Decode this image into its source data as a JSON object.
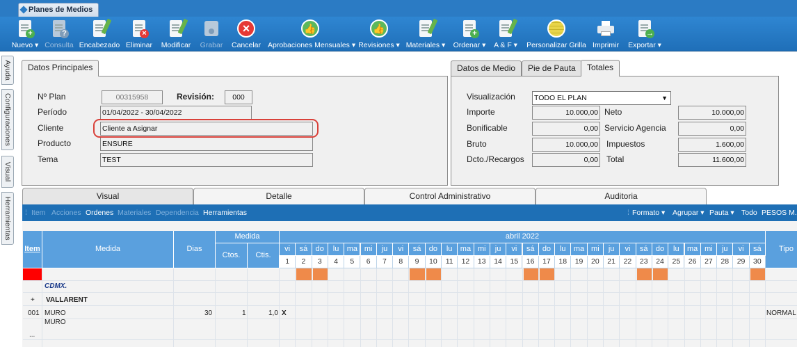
{
  "window": {
    "tab_title": "Planes de Medios"
  },
  "toolbar": {
    "nuevo": "Nuevo ▾",
    "consulta": "Consulta",
    "encabezado": "Encabezado",
    "eliminar": "Eliminar",
    "modificar": "Modificar",
    "grabar": "Grabar",
    "cancelar": "Cancelar",
    "aprobaciones": "Aprobaciones Mensuales ▾",
    "revisiones": "Revisiones ▾",
    "materiales": "Materiales ▾",
    "ordenar": "Ordenar ▾",
    "ayf": "A & F ▾",
    "personalizar": "Personalizar Grilla",
    "imprimir": "Imprimir",
    "exportar": "Exportar ▾"
  },
  "side_tabs": [
    "Ayuda",
    "Configuraciones",
    "Visual",
    "Herramientas"
  ],
  "datos_principales": {
    "tab_label": "Datos Principales",
    "plan_label": "Nº Plan",
    "plan_value": "00315958",
    "revision_label": "Revisión:",
    "revision_value": "000",
    "periodo_label": "Período",
    "periodo_value": "01/04/2022 - 30/04/2022",
    "cliente_label": "Cliente",
    "cliente_value": "Cliente a Asignar",
    "producto_label": "Producto",
    "producto_value": "ENSURE",
    "tema_label": "Tema",
    "tema_value": "TEST"
  },
  "totales": {
    "tabs": [
      "Datos de Medio",
      "Pie de Pauta",
      "Totales"
    ],
    "visualizacion_label": "Visualización",
    "visualizacion_value": "TODO EL PLAN",
    "importe_label": "Importe",
    "importe_value": "10.000,00",
    "neto_label": "Neto",
    "neto_value": "10.000,00",
    "bonificable_label": "Bonificable",
    "bonificable_value": "0,00",
    "servicio_label": "Servicio Agencia",
    "servicio_value": "0,00",
    "bruto_label": "Bruto",
    "bruto_value": "10.000,00",
    "impuestos_label": "Impuestos",
    "impuestos_value": "1.600,00",
    "dcto_label": "Dcto./Recargos",
    "dcto_value": "0,00",
    "total_label": "Total",
    "total_value": "11.600,00"
  },
  "main_tabs": [
    "Visual",
    "Detalle",
    "Control Administrativo",
    "Auditoria"
  ],
  "secbar": {
    "left": [
      "Item",
      "Acciones",
      "Ordenes",
      "Materiales",
      "Dependencia",
      "Herramientas"
    ],
    "right": [
      "Formato ▾",
      "Agrupar ▾",
      "Pauta ▾",
      "Todo",
      "PESOS M.N."
    ]
  },
  "grid": {
    "headers": {
      "item": "Item",
      "medida": "Medida",
      "dias": "Dias",
      "medida_group": "Medida",
      "ctos": "Ctos.",
      "ctis": "Ctis.",
      "month": "abril 2022",
      "tipo": "Tipo"
    },
    "day_names": [
      "vi",
      "sá",
      "do",
      "lu",
      "ma",
      "mi",
      "ju",
      "vi",
      "sá",
      "do",
      "lu",
      "ma",
      "mi",
      "ju",
      "vi",
      "sá",
      "do",
      "lu",
      "ma",
      "mi",
      "ju",
      "vi",
      "sá",
      "do",
      "lu",
      "ma",
      "mi",
      "ju",
      "vi",
      "sá"
    ],
    "weekend_days": [
      2,
      3,
      9,
      10,
      16,
      17,
      23,
      24,
      30
    ],
    "group1": "CDMX.",
    "group2_toggle": "+",
    "group2": "VALLARENT",
    "row": {
      "item": "001",
      "medida_line1": "MURO",
      "medida_line2": "MURO",
      "dias": "30",
      "ctos": "1",
      "ctis": "1,0",
      "day1": "X",
      "tipo": "NORMAL"
    },
    "more": "..."
  },
  "colors": {
    "toolbar": "#2f86d2",
    "grid_header": "#5aa0de",
    "weekend": "#ef8a4a",
    "highlight": "#d9413a"
  }
}
